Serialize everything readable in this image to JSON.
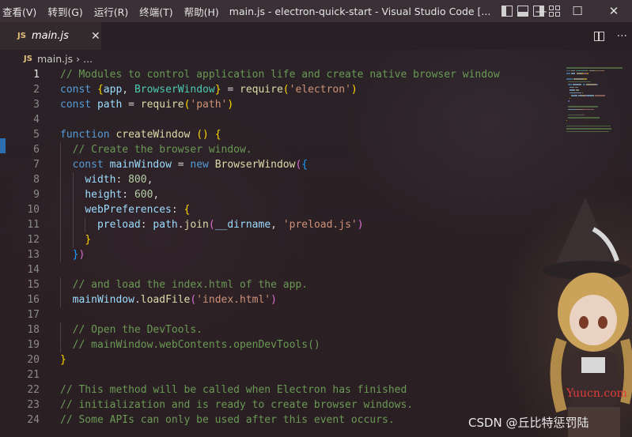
{
  "titlebar": {
    "menu": [
      "查看(V)",
      "转到(G)",
      "运行(R)",
      "终端(T)",
      "帮助(H)"
    ],
    "window_title": "main.js - electron-quick-start - Visual Studio Code [...",
    "controls": {
      "minimize": "—",
      "maximize": "☐",
      "close": "✕"
    }
  },
  "tab": {
    "badge": "JS",
    "name": "main.js",
    "close": "✕"
  },
  "tab_actions": {
    "more": "···"
  },
  "breadcrumb": {
    "badge": "JS",
    "file": "main.js",
    "sep": "›",
    "rest": "..."
  },
  "editor": {
    "active_line": 1,
    "lines": [
      {
        "n": "1",
        "indent": 0,
        "tokens": [
          {
            "t": "// Modules to control application life and create native browser window",
            "c": "com"
          }
        ]
      },
      {
        "n": "2",
        "indent": 0,
        "tokens": [
          {
            "t": "const ",
            "c": "kw"
          },
          {
            "t": "{",
            "c": "p1"
          },
          {
            "t": "app",
            "c": "var"
          },
          {
            "t": ", ",
            "c": "op"
          },
          {
            "t": "BrowserWindow",
            "c": "cls"
          },
          {
            "t": "}",
            "c": "p1"
          },
          {
            "t": " = ",
            "c": "op"
          },
          {
            "t": "require",
            "c": "fn"
          },
          {
            "t": "(",
            "c": "p1"
          },
          {
            "t": "'electron'",
            "c": "str"
          },
          {
            "t": ")",
            "c": "p1"
          }
        ]
      },
      {
        "n": "3",
        "indent": 0,
        "tokens": [
          {
            "t": "const ",
            "c": "kw"
          },
          {
            "t": "path",
            "c": "var"
          },
          {
            "t": " = ",
            "c": "op"
          },
          {
            "t": "require",
            "c": "fn"
          },
          {
            "t": "(",
            "c": "p1"
          },
          {
            "t": "'path'",
            "c": "str"
          },
          {
            "t": ")",
            "c": "p1"
          }
        ]
      },
      {
        "n": "4",
        "indent": 0,
        "tokens": []
      },
      {
        "n": "5",
        "indent": 0,
        "tokens": [
          {
            "t": "function ",
            "c": "kw"
          },
          {
            "t": "createWindow",
            "c": "fn"
          },
          {
            "t": " ",
            "c": "op"
          },
          {
            "t": "()",
            "c": "p1"
          },
          {
            "t": " ",
            "c": "op"
          },
          {
            "t": "{",
            "c": "p1"
          }
        ]
      },
      {
        "n": "6",
        "indent": 1,
        "tokens": [
          {
            "t": "// Create the browser window.",
            "c": "com"
          }
        ]
      },
      {
        "n": "7",
        "indent": 1,
        "tokens": [
          {
            "t": "const ",
            "c": "kw"
          },
          {
            "t": "mainWindow",
            "c": "var"
          },
          {
            "t": " = ",
            "c": "op"
          },
          {
            "t": "new ",
            "c": "kw"
          },
          {
            "t": "BrowserWindow",
            "c": "fn"
          },
          {
            "t": "(",
            "c": "p2"
          },
          {
            "t": "{",
            "c": "p3"
          }
        ]
      },
      {
        "n": "8",
        "indent": 2,
        "tokens": [
          {
            "t": "width",
            "c": "var"
          },
          {
            "t": ": ",
            "c": "op"
          },
          {
            "t": "800",
            "c": "num"
          },
          {
            "t": ",",
            "c": "op"
          }
        ]
      },
      {
        "n": "9",
        "indent": 2,
        "tokens": [
          {
            "t": "height",
            "c": "var"
          },
          {
            "t": ": ",
            "c": "op"
          },
          {
            "t": "600",
            "c": "num"
          },
          {
            "t": ",",
            "c": "op"
          }
        ]
      },
      {
        "n": "10",
        "indent": 2,
        "tokens": [
          {
            "t": "webPreferences",
            "c": "var"
          },
          {
            "t": ": ",
            "c": "op"
          },
          {
            "t": "{",
            "c": "p1"
          }
        ]
      },
      {
        "n": "11",
        "indent": 3,
        "tokens": [
          {
            "t": "preload",
            "c": "var"
          },
          {
            "t": ": ",
            "c": "op"
          },
          {
            "t": "path",
            "c": "var"
          },
          {
            "t": ".",
            "c": "op"
          },
          {
            "t": "join",
            "c": "fn"
          },
          {
            "t": "(",
            "c": "p2"
          },
          {
            "t": "__dirname",
            "c": "var"
          },
          {
            "t": ", ",
            "c": "op"
          },
          {
            "t": "'preload.js'",
            "c": "str"
          },
          {
            "t": ")",
            "c": "p2"
          }
        ]
      },
      {
        "n": "12",
        "indent": 2,
        "tokens": [
          {
            "t": "}",
            "c": "p1"
          }
        ]
      },
      {
        "n": "13",
        "indent": 1,
        "tokens": [
          {
            "t": "}",
            "c": "p3"
          },
          {
            "t": ")",
            "c": "p2"
          }
        ]
      },
      {
        "n": "14",
        "indent": 0,
        "tokens": []
      },
      {
        "n": "15",
        "indent": 1,
        "tokens": [
          {
            "t": "// and load the index.html of the app.",
            "c": "com"
          }
        ]
      },
      {
        "n": "16",
        "indent": 1,
        "tokens": [
          {
            "t": "mainWindow",
            "c": "var"
          },
          {
            "t": ".",
            "c": "op"
          },
          {
            "t": "loadFile",
            "c": "fn"
          },
          {
            "t": "(",
            "c": "p2"
          },
          {
            "t": "'index.html'",
            "c": "str"
          },
          {
            "t": ")",
            "c": "p2"
          }
        ]
      },
      {
        "n": "17",
        "indent": 0,
        "tokens": []
      },
      {
        "n": "18",
        "indent": 1,
        "tokens": [
          {
            "t": "// Open the DevTools.",
            "c": "com"
          }
        ]
      },
      {
        "n": "19",
        "indent": 1,
        "tokens": [
          {
            "t": "// mainWindow.webContents.openDevTools()",
            "c": "com"
          }
        ]
      },
      {
        "n": "20",
        "indent": 0,
        "tokens": [
          {
            "t": "}",
            "c": "p1"
          }
        ]
      },
      {
        "n": "21",
        "indent": 0,
        "tokens": []
      },
      {
        "n": "22",
        "indent": 0,
        "tokens": [
          {
            "t": "// This method will be called when Electron has finished",
            "c": "com"
          }
        ]
      },
      {
        "n": "23",
        "indent": 0,
        "tokens": [
          {
            "t": "// initialization and is ready to create browser windows.",
            "c": "com"
          }
        ]
      },
      {
        "n": "24",
        "indent": 0,
        "tokens": [
          {
            "t": "// Some APIs can only be used after this event occurs.",
            "c": "com"
          }
        ]
      }
    ]
  },
  "watermarks": {
    "site": "Yuucn.com",
    "author": "CSDN @丘比特惩罚陆"
  },
  "colors": {
    "accent": "#2c6fb0",
    "titlebar": "#3a3035",
    "comment": "#6a9955",
    "keyword": "#569cd6"
  }
}
